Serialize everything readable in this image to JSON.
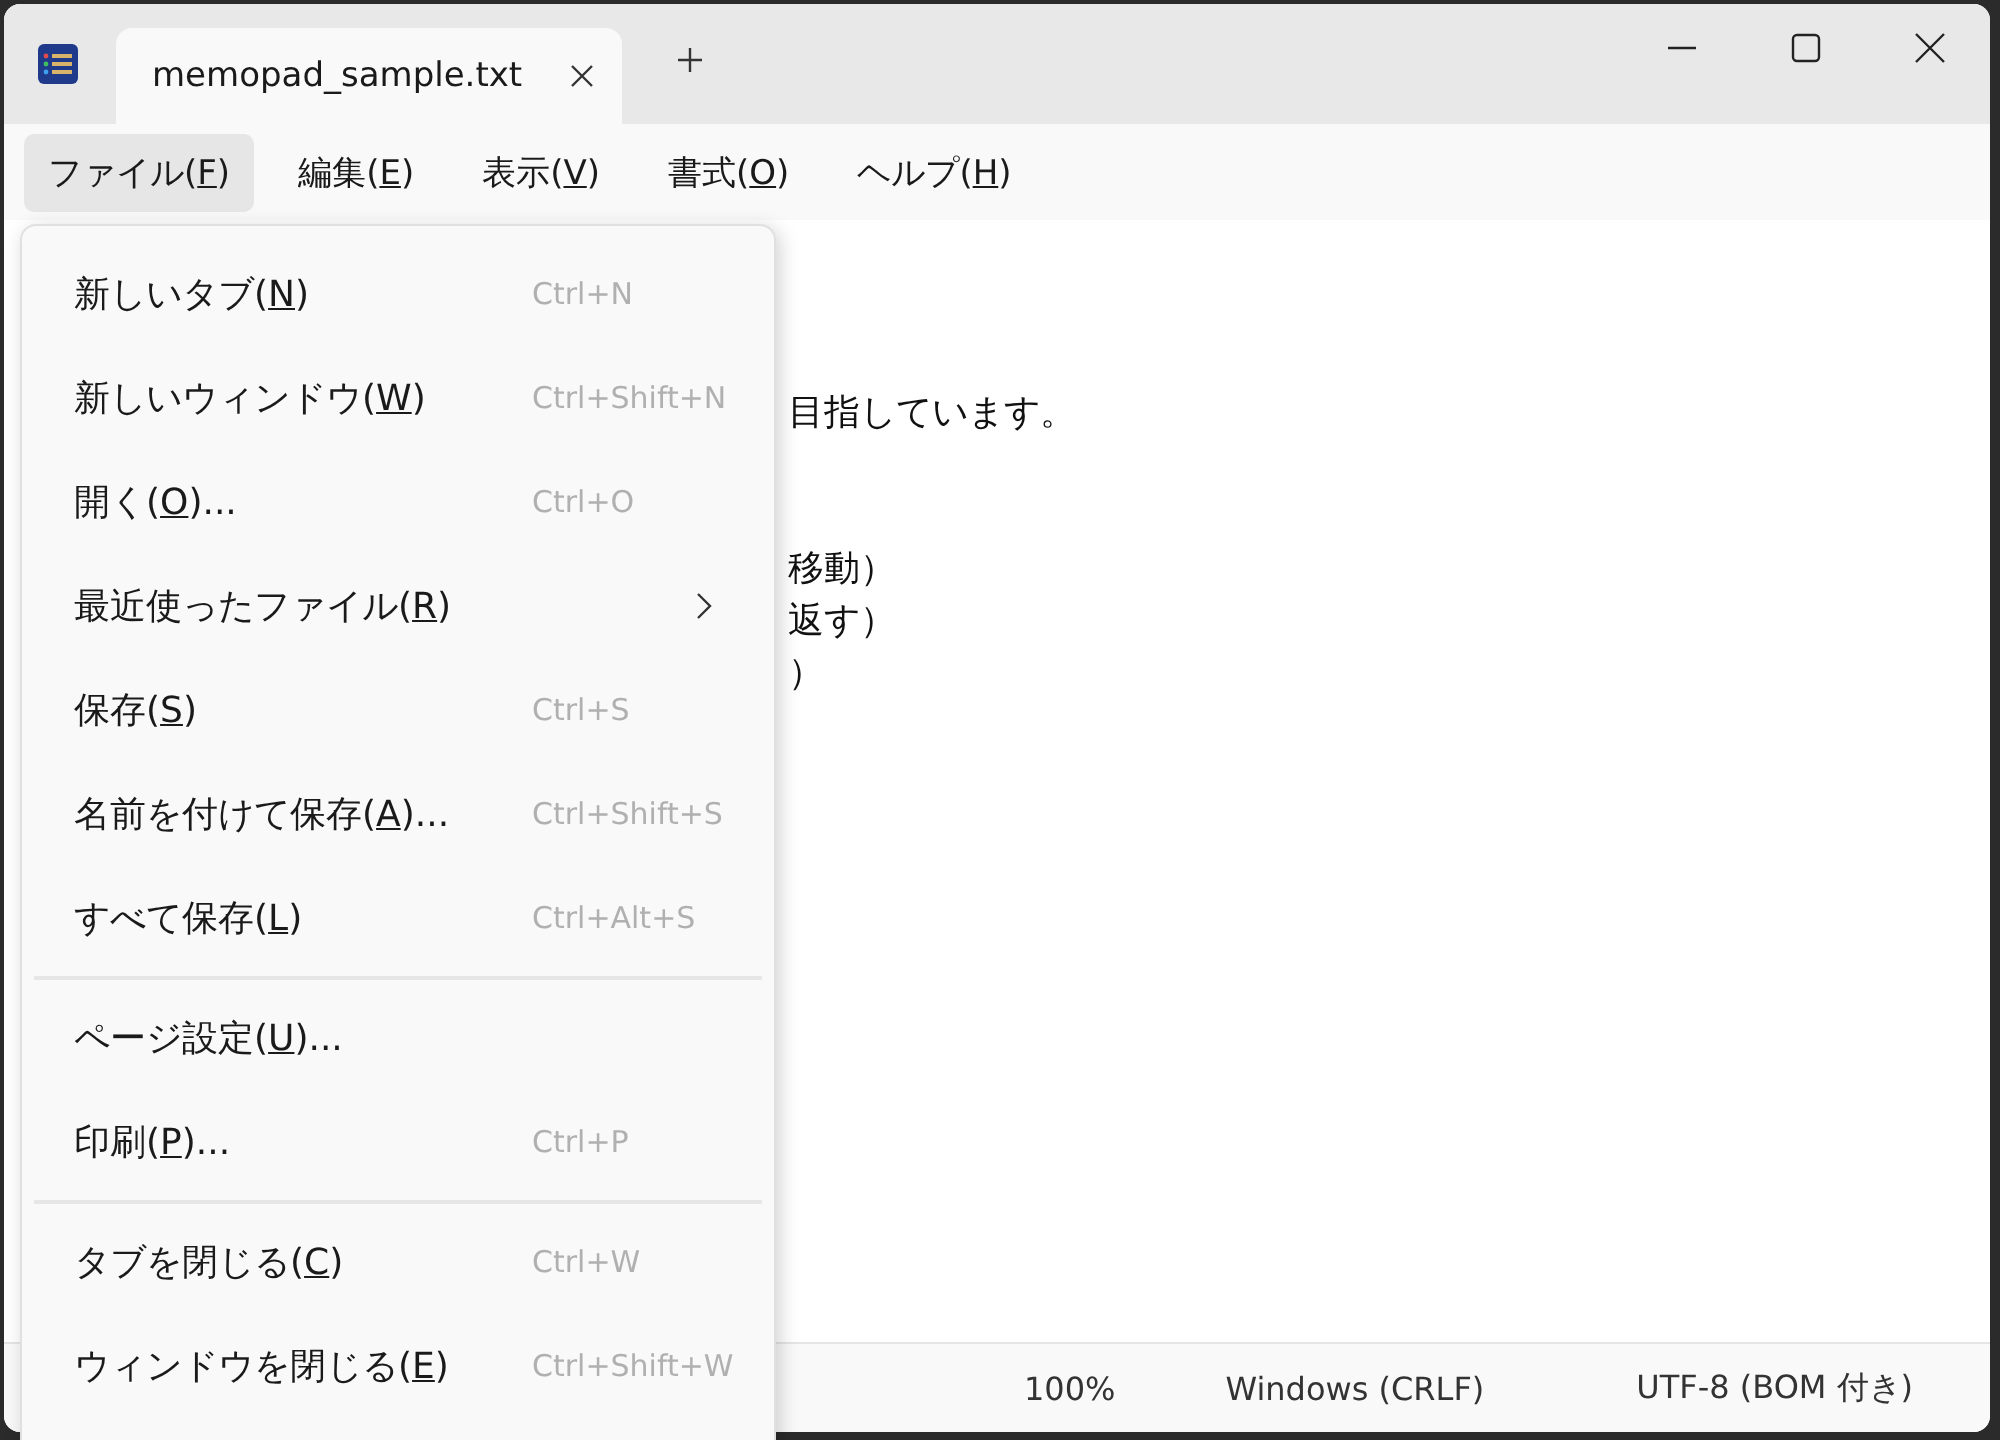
{
  "tabs": [
    {
      "label": "memopad_sample.txt",
      "selected": true
    }
  ],
  "menubar": [
    {
      "before": "ファイル(",
      "key": "F",
      "after": ")",
      "selected": true
    },
    {
      "before": "編集(",
      "key": "E",
      "after": ")",
      "selected": false
    },
    {
      "before": "表示(",
      "key": "V",
      "after": ")",
      "selected": false
    },
    {
      "before": "書式(",
      "key": "O",
      "after": ")",
      "selected": false
    },
    {
      "before": "ヘルプ(",
      "key": "H",
      "after": ")",
      "selected": false
    }
  ],
  "editor": {
    "paragraphs": [
      [
        "目指しています。"
      ],
      [
        "移動）",
        "返す）",
        "）"
      ]
    ]
  },
  "file_menu": [
    {
      "kind": "command",
      "before": "新しいタブ(",
      "key": "N",
      "after": ")",
      "shortcut": "Ctrl+N"
    },
    {
      "kind": "command",
      "before": "新しいウィンドウ(",
      "key": "W",
      "after": ")",
      "shortcut": "Ctrl+Shift+N"
    },
    {
      "kind": "command",
      "before": "開く(",
      "key": "O",
      "after": ")...",
      "shortcut": "Ctrl+O"
    },
    {
      "kind": "submenu",
      "before": "最近使ったファイル(",
      "key": "R",
      "after": ")"
    },
    {
      "kind": "command",
      "before": "保存(",
      "key": "S",
      "after": ")",
      "shortcut": "Ctrl+S"
    },
    {
      "kind": "command",
      "before": "名前を付けて保存(",
      "key": "A",
      "after": ")...",
      "shortcut": "Ctrl+Shift+S"
    },
    {
      "kind": "command",
      "before": "すべて保存(",
      "key": "L",
      "after": ")",
      "shortcut": "Ctrl+Alt+S"
    },
    {
      "kind": "separator"
    },
    {
      "kind": "command",
      "before": "ページ設定(",
      "key": "U",
      "after": ")..."
    },
    {
      "kind": "command",
      "before": "印刷(",
      "key": "P",
      "after": ")...",
      "shortcut": "Ctrl+P"
    },
    {
      "kind": "separator"
    },
    {
      "kind": "command",
      "before": "タブを閉じる(",
      "key": "C",
      "after": ")",
      "shortcut": "Ctrl+W"
    },
    {
      "kind": "command",
      "before": "ウィンドウを閉じる(",
      "key": "E",
      "after": ")",
      "shortcut": "Ctrl+Shift+W"
    }
  ],
  "status_bar": [
    "100%",
    "Windows (CRLF)",
    "UTF-8 (BOM 付き)"
  ]
}
